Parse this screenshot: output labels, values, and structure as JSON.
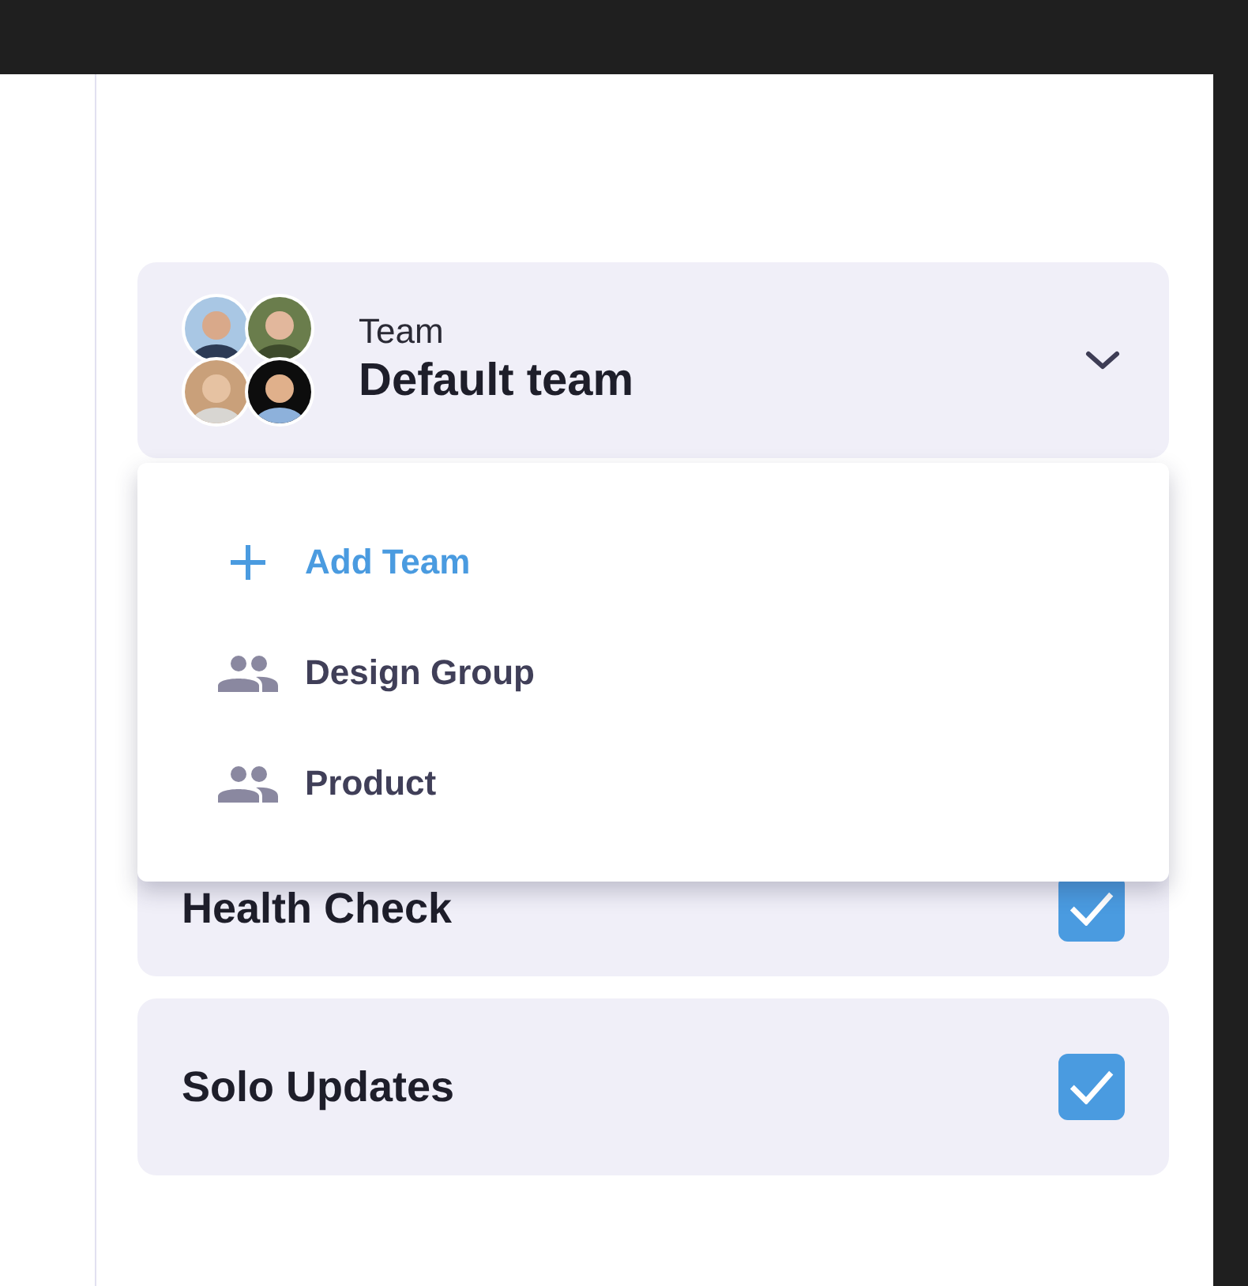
{
  "team_selector": {
    "label": "Team",
    "value": "Default team",
    "expanded": true
  },
  "dropdown": {
    "items": [
      {
        "kind": "add",
        "label": "Add Team"
      },
      {
        "kind": "team",
        "label": "Design Group"
      },
      {
        "kind": "team",
        "label": "Product"
      }
    ]
  },
  "settings": [
    {
      "label": "Health Check",
      "checked": true
    },
    {
      "label": "Solo Updates",
      "checked": true
    }
  ]
}
